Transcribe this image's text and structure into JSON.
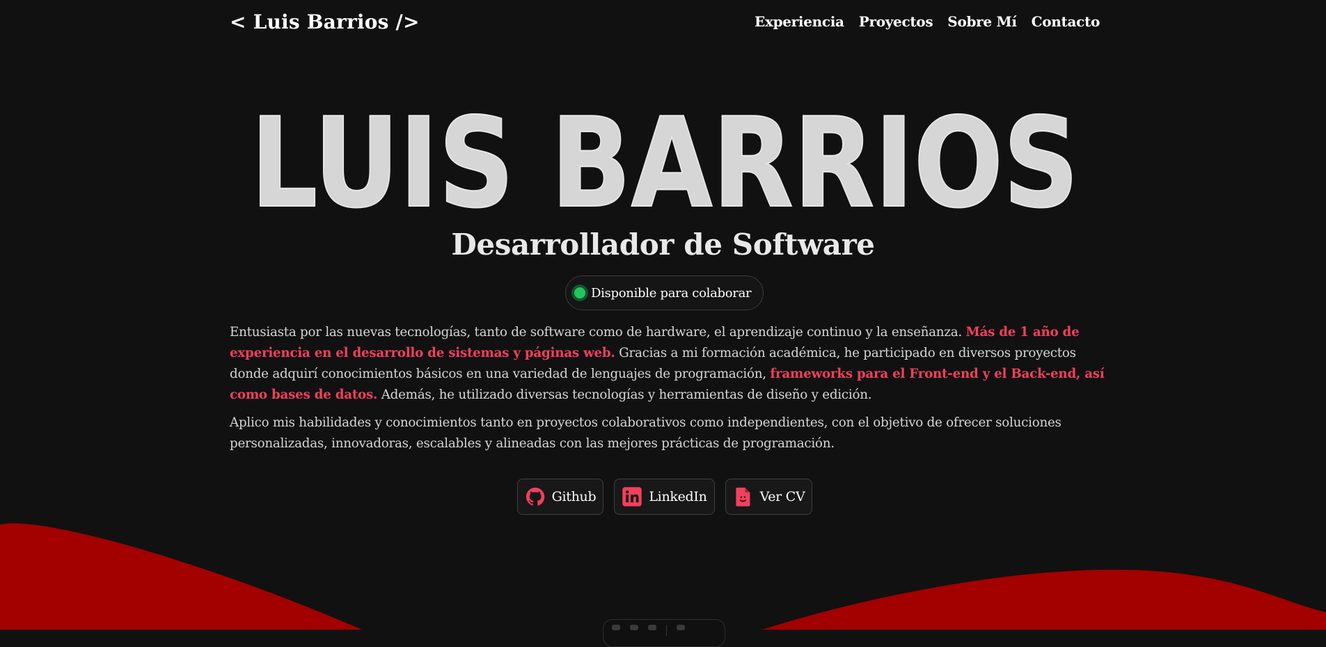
{
  "header": {
    "logo": "< Luis Barrios />",
    "nav": [
      {
        "label": "Experiencia"
      },
      {
        "label": "Proyectos"
      },
      {
        "label": "Sobre Mí"
      },
      {
        "label": "Contacto"
      }
    ]
  },
  "hero": {
    "name": "LUIS BARRIOS",
    "subtitle": "Desarrollador de Software",
    "status": "Disponible para colaborar"
  },
  "about": {
    "p1": {
      "t1": "Entusiasta por las nuevas tecnologías, tanto de software como de hardware, el aprendizaje continuo y la enseñanza. ",
      "h1": "Más de 1 año de experiencia en el desarrollo de sistemas y páginas web.",
      "t2": " Gracias a mi formación académica, he participado en diversos proyectos donde adquirí conocimientos básicos en una variedad de lenguajes de programación, ",
      "h2": "frameworks para el Front-end y el Back-end, así como bases de datos.",
      "t3": " Además, he utilizado diversas tecnologías y herramientas de diseño y edición."
    },
    "p2": "Aplico mis habilidades y conocimientos tanto en proyectos colaborativos como independientes, con el objetivo de ofrecer soluciones personalizadas, innovadoras, escalables y alineadas con las mejores prácticas de programación."
  },
  "social": [
    {
      "label": "Github",
      "icon": "github-icon"
    },
    {
      "label": "LinkedIn",
      "icon": "linkedin-icon"
    },
    {
      "label": "Ver CV",
      "icon": "cv-file-icon"
    }
  ],
  "colors": {
    "background": "#111111",
    "accent": "#f43f5e",
    "status_dot": "#22c55e",
    "wave": "#a30000",
    "name_fill": "#d6d6d6"
  }
}
